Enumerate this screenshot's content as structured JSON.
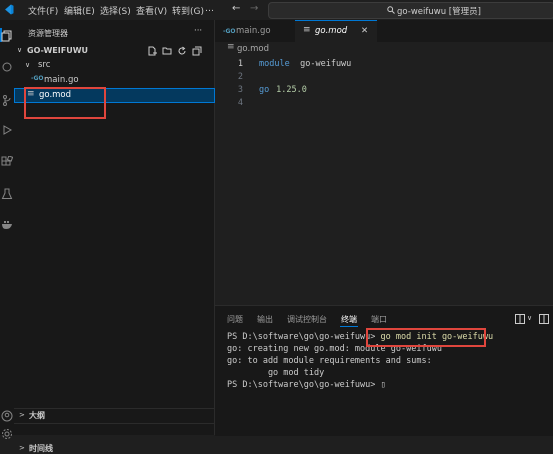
{
  "menu": [
    "文件(F)",
    "编辑(E)",
    "选择(S)",
    "查看(V)",
    "转到(G)",
    "…"
  ],
  "search": {
    "text": "go-weifuwu [管理员]"
  },
  "sidebar": {
    "title": "资源管理器",
    "more": "···",
    "project": "GO-WEIFUWU",
    "folder": "src",
    "files": [
      {
        "icon": "-GO",
        "name": "main.go"
      },
      {
        "icon": "≡",
        "name": "go.mod"
      }
    ],
    "outline": "大纲",
    "timeline": "时间线"
  },
  "tabs": [
    {
      "icon": "-GO",
      "label": "main.go"
    },
    {
      "icon": "≡",
      "label": "go.mod",
      "close": "✕"
    }
  ],
  "breadcrumb": {
    "icon": "≡",
    "label": "go.mod"
  },
  "code": [
    {
      "n": "1",
      "kw": "module",
      "rest": " go-weifuwu"
    },
    {
      "n": "2",
      "kw": "",
      "rest": ""
    },
    {
      "n": "3",
      "kw": "go",
      "rest": " 1.25.0"
    },
    {
      "n": "4",
      "kw": "",
      "rest": ""
    }
  ],
  "panel": {
    "tabs": [
      "问题",
      "输出",
      "调试控制台",
      "终端",
      "端口"
    ],
    "active": 3,
    "terminal": {
      "prompt1": "PS D:\\software\\go\\go-weifuwu> ",
      "cmd1": "go mod init go-weifuwu",
      "line2": "go: creating new go.mod: module go-weifuwu",
      "line3": "go: to add module requirements and sums:",
      "line4": "        go mod tidy",
      "prompt2": "PS D:\\software\\go\\go-weifuwu> ",
      "cursor": "▯"
    }
  },
  "colors": {
    "accent": "#0078d4",
    "keyword": "#569cd6",
    "number": "#b5cea8",
    "ident": "#cccccc",
    "highlight": "#e0463d"
  }
}
